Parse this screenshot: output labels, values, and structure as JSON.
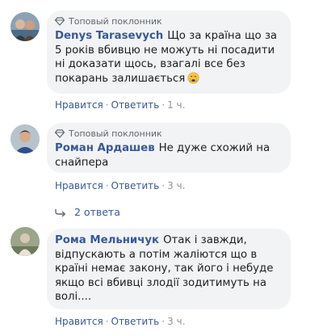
{
  "comments": [
    {
      "badge": "Топовый поклонник",
      "author": "Denys Tarasevych",
      "text": "Що за країна що за 5 років вбивцю не можуть ні посадити ні доказати щось, взагалі все без покарань залишається",
      "reaction_icon": "crying-emoji-icon",
      "actions": {
        "like": "Нравится",
        "reply": "Ответить",
        "time": "1 ч."
      }
    },
    {
      "badge": "Топовый поклонник",
      "author": "Роман Ардашев",
      "text": "Не дуже схожий на снайпера",
      "actions": {
        "like": "Нравится",
        "reply": "Ответить",
        "time": "3 ч."
      }
    },
    {
      "author": "Рома Мельничук",
      "text": "Отак і завжди, відпускають а потім жаліются що в країні немає закону, так його і небуде якщо всі вбивці злодії зодитимуть на волі....",
      "actions": {
        "like": "Нравится",
        "reply": "Ответить",
        "time": "3 ч."
      }
    }
  ],
  "replies": {
    "label": "2 ответа",
    "icon": "reply-arrow-icon"
  },
  "colors": {
    "link": "#385898",
    "bubble": "#f2f3f5",
    "meta": "#90949c"
  }
}
